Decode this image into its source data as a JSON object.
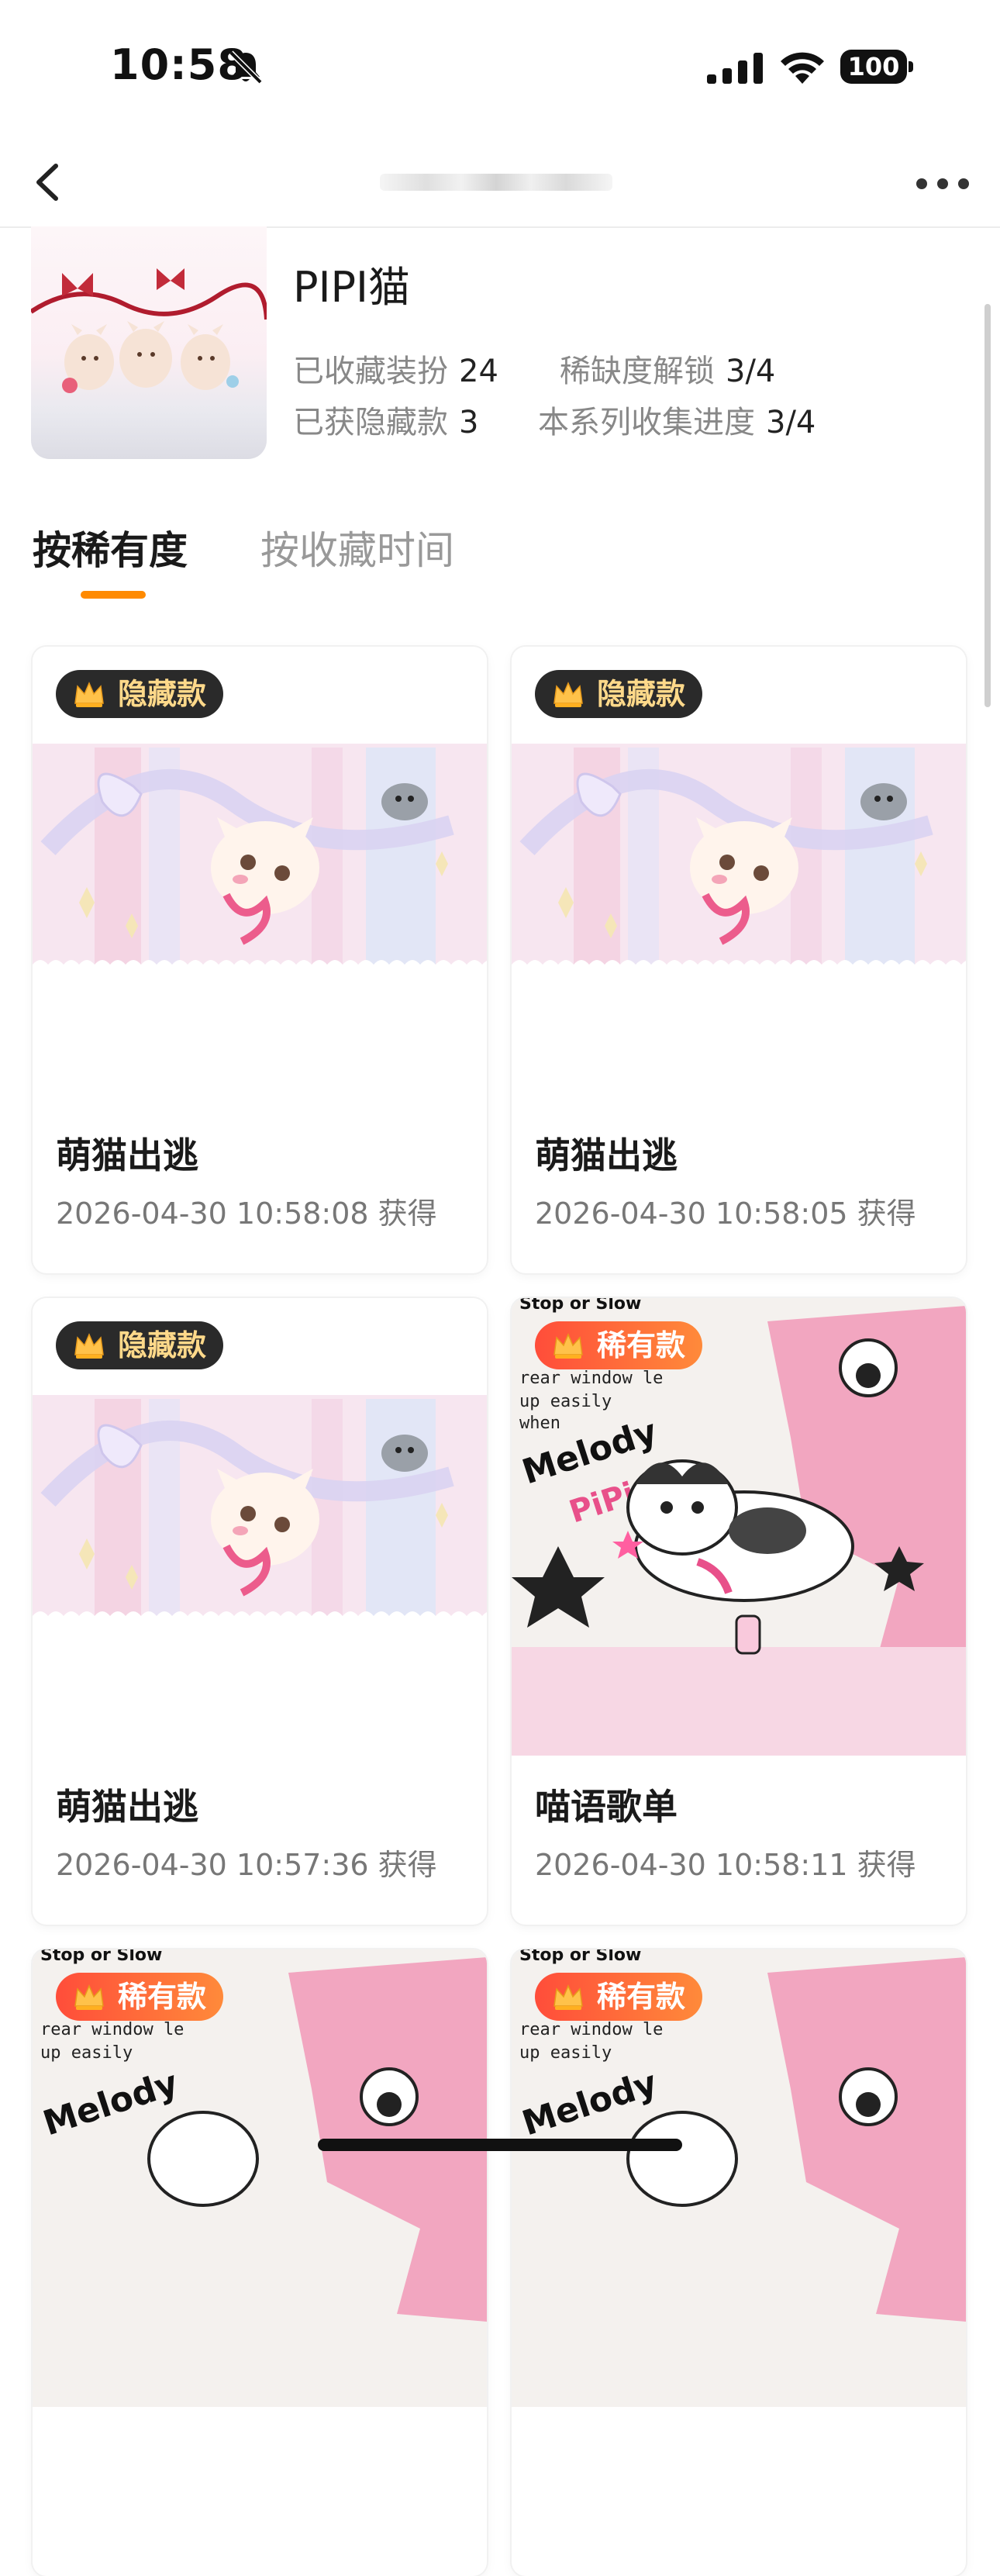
{
  "status_bar": {
    "time": "10:58",
    "battery": "100"
  },
  "header": {
    "series_name": "PIPI猫",
    "stats": [
      {
        "label": "已收藏装扮",
        "value": "24"
      },
      {
        "label": "稀缺度解锁",
        "value": "3/4"
      },
      {
        "label": "已获隐藏款",
        "value": "3"
      },
      {
        "label": "本系列收集进度",
        "value": "3/4"
      }
    ]
  },
  "tabs": [
    {
      "label": "按稀有度",
      "active": true
    },
    {
      "label": "按收藏时间",
      "active": false
    }
  ],
  "cards": [
    {
      "badge": "隐藏款",
      "name": "萌猫出逃",
      "date": "2026-04-30 10:58:08 获得"
    },
    {
      "badge": "隐藏款",
      "name": "萌猫出逃",
      "date": "2026-04-30 10:58:05 获得"
    },
    {
      "badge": "隐藏款",
      "name": "萌猫出逃",
      "date": "2026-04-30 10:57:36 获得"
    },
    {
      "badge": "稀有款",
      "name": "喵语歌单",
      "date": "2026-04-30 10:58:11 获得"
    },
    {
      "badge": "稀有款"
    },
    {
      "badge": "稀有款"
    }
  ],
  "artwork_text": {
    "stop_or_slow": "Stop or Slow",
    "melody": "Melody",
    "pipi": "PiPi"
  },
  "colors": {
    "accent": "#ff8a00",
    "hidden_badge": "#2a2a2a",
    "rare_badge": "#ff5a3a"
  },
  "icons": [
    "back-icon",
    "more-icon",
    "bell-off-icon",
    "signal-icon",
    "wifi-icon",
    "battery-icon",
    "crown-icon"
  ]
}
